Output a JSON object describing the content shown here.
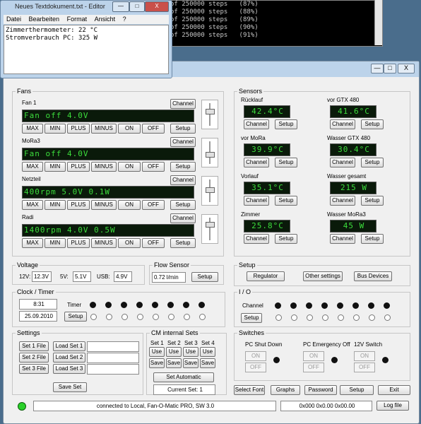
{
  "console": {
    "lines": [
      "of 250000 steps   (87%)",
      "of 250000 steps   (88%)",
      "of 250000 steps   (89%)",
      "of 250000 steps   (90%)",
      "of 250000 steps   (91%)"
    ]
  },
  "notepad": {
    "title": "Neues Textdokument.txt - Editor",
    "menu": [
      "Datei",
      "Bearbeiten",
      "Format",
      "Ansicht",
      "?"
    ],
    "text": [
      "Zimmerthermometer: 22 °C",
      "Stromverbrauch PC: 325 W"
    ],
    "btn_min": "—",
    "btn_max": "□",
    "btn_close": "X"
  },
  "mainwin": {
    "btn_min": "—",
    "btn_max": "□",
    "btn_close": "X"
  },
  "fans": {
    "title": "Fans",
    "items": [
      {
        "name": "Fan 1",
        "lcd": "Fan off  4.0V",
        "channel": "Channel",
        "thumb": 0.3
      },
      {
        "name": "MoRa3",
        "lcd": "Fan off  4.0V",
        "channel": "Channel",
        "thumb": 0.55
      },
      {
        "name": "Netzteil",
        "lcd": "400rpm  5.0V  0.1W",
        "channel": "Channel",
        "thumb": 0.4
      },
      {
        "name": "Radi",
        "lcd": "1400rpm  4.0V  0.5W",
        "channel": "Channel",
        "thumb": 0.2
      }
    ],
    "buttons": [
      "MAX",
      "MIN",
      "PLUS",
      "MINUS",
      "ON",
      "OFF",
      "Setup"
    ]
  },
  "sensors": {
    "title": "Sensors",
    "items": [
      {
        "name": "Rücklauf",
        "value": "42.4°C"
      },
      {
        "name": "vor GTX 480",
        "value": "41.6°C"
      },
      {
        "name": "vor MoRa",
        "value": "39.9°C"
      },
      {
        "name": "Wasser GTX 480",
        "value": "30.4°C"
      },
      {
        "name": "Vorlauf",
        "value": "35.1°C"
      },
      {
        "name": "Wasser gesamt",
        "value": "215 W"
      },
      {
        "name": "Zimmer",
        "value": "25.8°C"
      },
      {
        "name": "Wasser MoRa3",
        "value": "45 W"
      }
    ],
    "channel": "Channel",
    "setup": "Setup"
  },
  "voltage": {
    "title": "Voltage",
    "items": [
      {
        "label": "12V:",
        "value": "12.3V"
      },
      {
        "label": "5V:",
        "value": "5.1V"
      },
      {
        "label": "USB:",
        "value": "4.9V"
      }
    ]
  },
  "flow": {
    "title": "Flow Sensor",
    "value": "0.72 l/min",
    "setup": "Setup"
  },
  "setup_group": {
    "title": "Setup",
    "buttons": [
      "Regulator",
      "Other settings",
      "Bus Devices"
    ]
  },
  "clock": {
    "title": "Clock / Timer",
    "time": "8:31",
    "date": "25.09.2010",
    "timer_label": "Timer",
    "setup": "Setup"
  },
  "io": {
    "title": "I / O",
    "channel_label": "Channel",
    "setup": "Setup"
  },
  "settings": {
    "title": "Settings",
    "rows": [
      {
        "set": "Set 1 File",
        "load": "Load Set 1"
      },
      {
        "set": "Set 2 File",
        "load": "Load Set 2"
      },
      {
        "set": "Set 3 File",
        "load": "Load Set 3"
      }
    ],
    "save": "Save Set"
  },
  "internal": {
    "title": "CM internal Sets",
    "sets": [
      "Set 1",
      "Set 2",
      "Set 3",
      "Set 4"
    ],
    "use": "Use",
    "save": "Save",
    "automatic": "Set Automatic",
    "current": "Current Set: 1"
  },
  "switches": {
    "title": "Switches",
    "items": [
      {
        "name": "PC Shut Down",
        "on": "ON",
        "off": "OFF"
      },
      {
        "name": "PC Emergency Off",
        "on": "ON",
        "off": "OFF"
      },
      {
        "name": "12V Switch",
        "on": "ON",
        "off": "OFF"
      }
    ]
  },
  "bottom_buttons": [
    "Select Font",
    "Graphs",
    "Password",
    "Setup",
    "Exit"
  ],
  "status": {
    "text": "connected to Local, Fan-O-Matic PRO, SW 3.0",
    "code": "0x000 0x0.00 0x00.00",
    "log": "Log file"
  },
  "colors": {
    "lcd_bg": "#0a1a0a",
    "lcd_fg": "#3cdc3c",
    "status_led": "#2ad02a"
  }
}
